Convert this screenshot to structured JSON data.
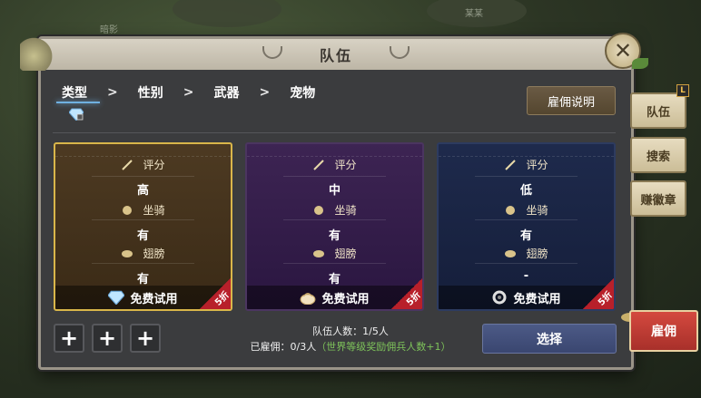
{
  "background": {
    "labels": [
      "暗影",
      "某某"
    ]
  },
  "panel": {
    "title": "队伍",
    "close_glyph": "✕"
  },
  "breadcrumb": {
    "items": [
      "类型",
      "性别",
      "武器",
      "宠物"
    ],
    "separator": ">"
  },
  "hire_info_button": "雇佣说明",
  "cards": [
    {
      "theme": "gold",
      "rows": [
        {
          "icon": "sword-icon",
          "label": "评分",
          "value": "高"
        },
        {
          "icon": "mount-icon",
          "label": "坐骑",
          "value": "有"
        },
        {
          "icon": "wings-icon",
          "label": "翅膀",
          "value": "有"
        }
      ],
      "footer_icon": "diamond-icon",
      "footer_text": "免费试用",
      "discount": "5折"
    },
    {
      "theme": "purple",
      "rows": [
        {
          "icon": "sword-icon",
          "label": "评分",
          "value": "中"
        },
        {
          "icon": "mount-icon",
          "label": "坐骑",
          "value": "有"
        },
        {
          "icon": "wings-icon",
          "label": "翅膀",
          "value": "有"
        }
      ],
      "footer_icon": "bun-icon",
      "footer_text": "免费试用",
      "discount": "5折"
    },
    {
      "theme": "blue",
      "rows": [
        {
          "icon": "sword-icon",
          "label": "评分",
          "value": "低"
        },
        {
          "icon": "mount-icon",
          "label": "坐骑",
          "value": "有"
        },
        {
          "icon": "wings-icon",
          "label": "翅膀",
          "value": "-"
        }
      ],
      "footer_icon": "ring-icon",
      "footer_text": "免费试用",
      "discount": "5折"
    }
  ],
  "plus_slots": [
    "+",
    "+",
    "+"
  ],
  "team_count": "队伍人数：1/5人",
  "hired": {
    "prefix": "已雇佣：0/3人",
    "bonus": "（世界等级奖励佣兵人数+1）"
  },
  "select_button": "选择",
  "side_tabs": [
    "队伍",
    "搜索",
    "赚徽章"
  ],
  "side_badge": "L",
  "hire_tab": "雇佣",
  "colors": {
    "accent_gold": "#d9b64a",
    "card_purple": "#3d2453",
    "card_blue": "#1e2a4c",
    "hire_red": "#c23c34",
    "bonus_green": "#7ec35a"
  }
}
